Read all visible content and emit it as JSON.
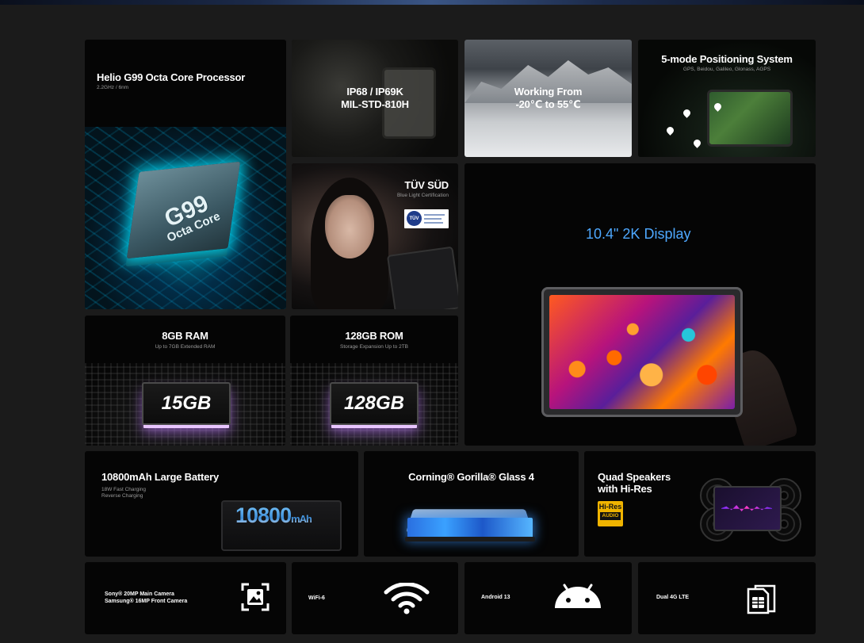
{
  "tiles": {
    "cpu": {
      "title": "Helio G99 Octa Core Processor",
      "sub": "2.2GHz / 6nm",
      "chip_big": "G99",
      "chip_small": "Octa Core"
    },
    "rugged": {
      "line1": "IP68 / IP69K",
      "line2": "MIL-STD-810H"
    },
    "temp": {
      "line1": "Working From",
      "line2": "-20℃ to 55℃"
    },
    "gps": {
      "title": "5-mode Positioning System",
      "sub": "GPS, Beidou, Galileo, Glonass, AGPS"
    },
    "tuv": {
      "title": "TÜV SÜD",
      "sub": "Blue Light Certification",
      "badge": "TÜV"
    },
    "display": {
      "title": "10.4\" 2K Display"
    },
    "ram": {
      "title": "8GB RAM",
      "sub": "Up to 7GB Extended RAM",
      "chip": "15GB"
    },
    "rom": {
      "title": "128GB ROM",
      "sub": "Storage Expansion Up to 2TB",
      "chip": "128GB"
    },
    "battery": {
      "title": "10800mAh Large Battery",
      "sub1": "18W Fast Charging",
      "sub2": "Reverse Charging",
      "num": "10800",
      "unit": "mAh"
    },
    "gorilla": {
      "title": "Corning® Gorilla® Glass 4"
    },
    "speakers": {
      "line1": "Quad Speakers",
      "line2": "with Hi-Res",
      "badge_top": "Hi-Res",
      "badge_bot": "AUDIO"
    },
    "camera": {
      "line1": "Sony® 20MP Main Camera",
      "line2": "Samsung® 16MP Front Camera",
      "icon": "image-icon"
    },
    "wifi": {
      "label": "WiFi-6",
      "icon": "wifi-icon"
    },
    "android": {
      "label": "Android 13",
      "icon": "android-icon"
    },
    "lte": {
      "label": "Dual 4G LTE",
      "icon": "sim-card-icon"
    }
  },
  "colors": {
    "accent_blue": "#4ea8ff",
    "background": "#1b1b1b",
    "tile": "#050505",
    "hires_gold": "#f0b400"
  }
}
